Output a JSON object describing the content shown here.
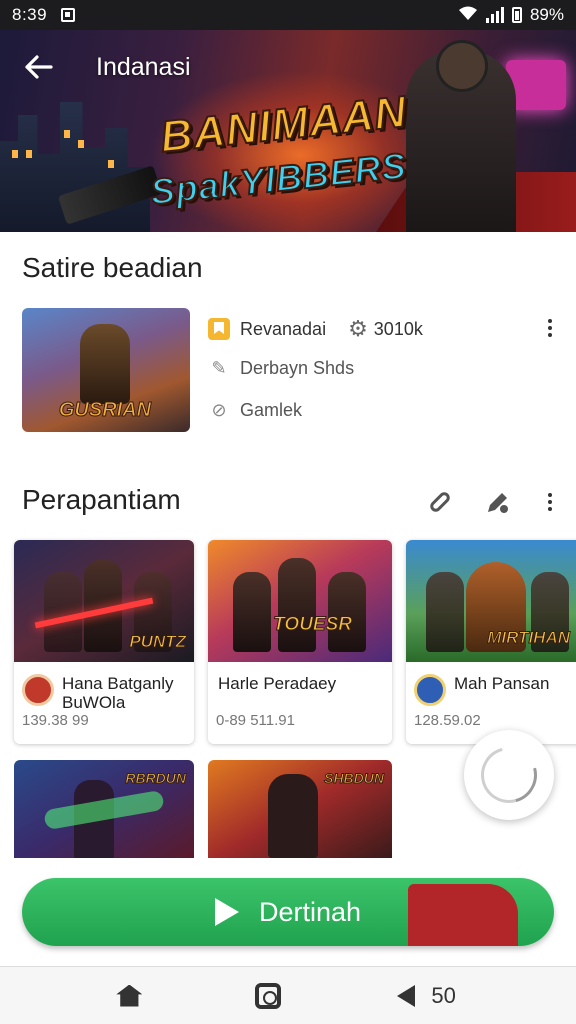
{
  "status_bar": {
    "time": "8:39",
    "battery": "89%"
  },
  "header": {
    "title": "Indanasi"
  },
  "banner": {
    "line1": "BANIMAAN",
    "line2": "SpakYIBBERS"
  },
  "featured_section": {
    "title": "Satire beadian",
    "thumb_label": "GUSRIAN",
    "publisher": "Revanadai",
    "rating": "3010k",
    "line2": "Derbayn Shds",
    "line3": "Gamlek"
  },
  "list_section": {
    "title": "Perapantiam"
  },
  "cards": [
    {
      "art_label": "PUNTZ",
      "name": "Hana Batganly\nBuWOla",
      "meta": "139.38 99",
      "avatar_color": "#c0392b"
    },
    {
      "art_label": "TOUESR",
      "name": "Harle Peradaey",
      "meta": "0-89 511.91",
      "avatar_color": ""
    },
    {
      "art_label": "MIRTIHAN",
      "name": "Mah Pansan",
      "meta": "128.59.02",
      "avatar_color": "#2e5fb4"
    }
  ],
  "row2_cards": [
    {
      "art_label": "RBRDUN"
    },
    {
      "art_label": "SHBDUN"
    }
  ],
  "cta": {
    "label": "Dertinah"
  },
  "navbar": {
    "right_label": "50"
  },
  "colors": {
    "cta_green": "#20a24e",
    "accent_yellow": "#f6b730"
  }
}
